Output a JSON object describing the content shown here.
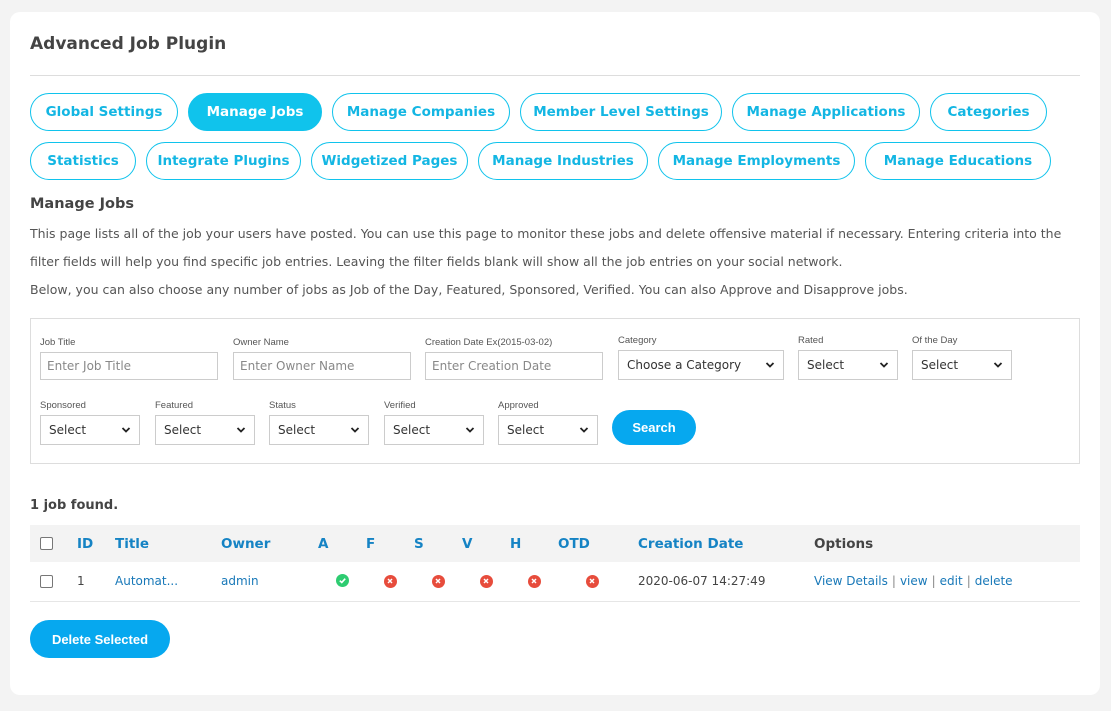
{
  "page": {
    "title": "Advanced Job Plugin"
  },
  "tabs": {
    "row1": [
      {
        "label": "Global Settings",
        "active": false
      },
      {
        "label": "Manage Jobs",
        "active": true
      },
      {
        "label": "Manage Companies",
        "active": false
      },
      {
        "label": "Member Level Settings",
        "active": false
      },
      {
        "label": "Manage Applications",
        "active": false
      },
      {
        "label": "Categories",
        "active": false
      }
    ],
    "row2": [
      {
        "label": "Statistics",
        "active": false
      },
      {
        "label": "Integrate Plugins",
        "active": false
      },
      {
        "label": "Widgetized Pages",
        "active": false
      },
      {
        "label": "Manage Industries",
        "active": false
      },
      {
        "label": "Manage Employments",
        "active": false
      },
      {
        "label": "Manage Educations",
        "active": false
      }
    ]
  },
  "section": {
    "title": "Manage Jobs",
    "description": [
      "This page lists all of the job your users have posted. You can use this page to monitor these jobs and delete offensive material if necessary. Entering criteria into the filter fields will help you find specific job entries. Leaving the filter fields blank will show all the job entries on your social network.",
      "Below, you can also choose any number of jobs as Job of the Day, Featured, Sponsored, Verified. You can also Approve and Disapprove jobs."
    ]
  },
  "filters": {
    "job_title": {
      "label": "Job Title",
      "placeholder": "Enter Job Title",
      "value": ""
    },
    "owner_name": {
      "label": "Owner Name",
      "placeholder": "Enter Owner Name",
      "value": ""
    },
    "creation_date": {
      "label": "Creation Date Ex(2015-03-02)",
      "placeholder": "Enter Creation Date",
      "value": ""
    },
    "category": {
      "label": "Category",
      "selected": "Choose a Category"
    },
    "rated": {
      "label": "Rated",
      "selected": "Select"
    },
    "of_the_day": {
      "label": "Of the Day",
      "selected": "Select"
    },
    "sponsored": {
      "label": "Sponsored",
      "selected": "Select"
    },
    "featured": {
      "label": "Featured",
      "selected": "Select"
    },
    "status": {
      "label": "Status",
      "selected": "Select"
    },
    "verified": {
      "label": "Verified",
      "selected": "Select"
    },
    "approved": {
      "label": "Approved",
      "selected": "Select"
    },
    "search_label": "Search"
  },
  "results": {
    "count_text": "1 job found.",
    "columns": {
      "id": "ID",
      "title": "Title",
      "owner": "Owner",
      "a": "A",
      "f": "F",
      "s": "S",
      "v": "V",
      "h": "H",
      "otd": "OTD",
      "creation_date": "Creation Date",
      "options": "Options"
    },
    "rows": [
      {
        "id": "1",
        "title": "Automat...",
        "owner": "admin",
        "a": "check-icon",
        "f": "cross-icon",
        "s": "cross-icon",
        "v": "cross-icon",
        "h": "cross-icon",
        "otd": "cross-icon",
        "creation_date": "2020-06-07 14:27:49",
        "options": [
          "View Details",
          "view",
          "edit",
          "delete"
        ]
      }
    ],
    "delete_selected_label": "Delete Selected"
  },
  "colors": {
    "accent": "#10c3ec",
    "button": "#06a8ef",
    "link": "#1878b8",
    "header_link": "#1583c4",
    "ok": "#2ecc71",
    "no": "#e74c3c"
  }
}
